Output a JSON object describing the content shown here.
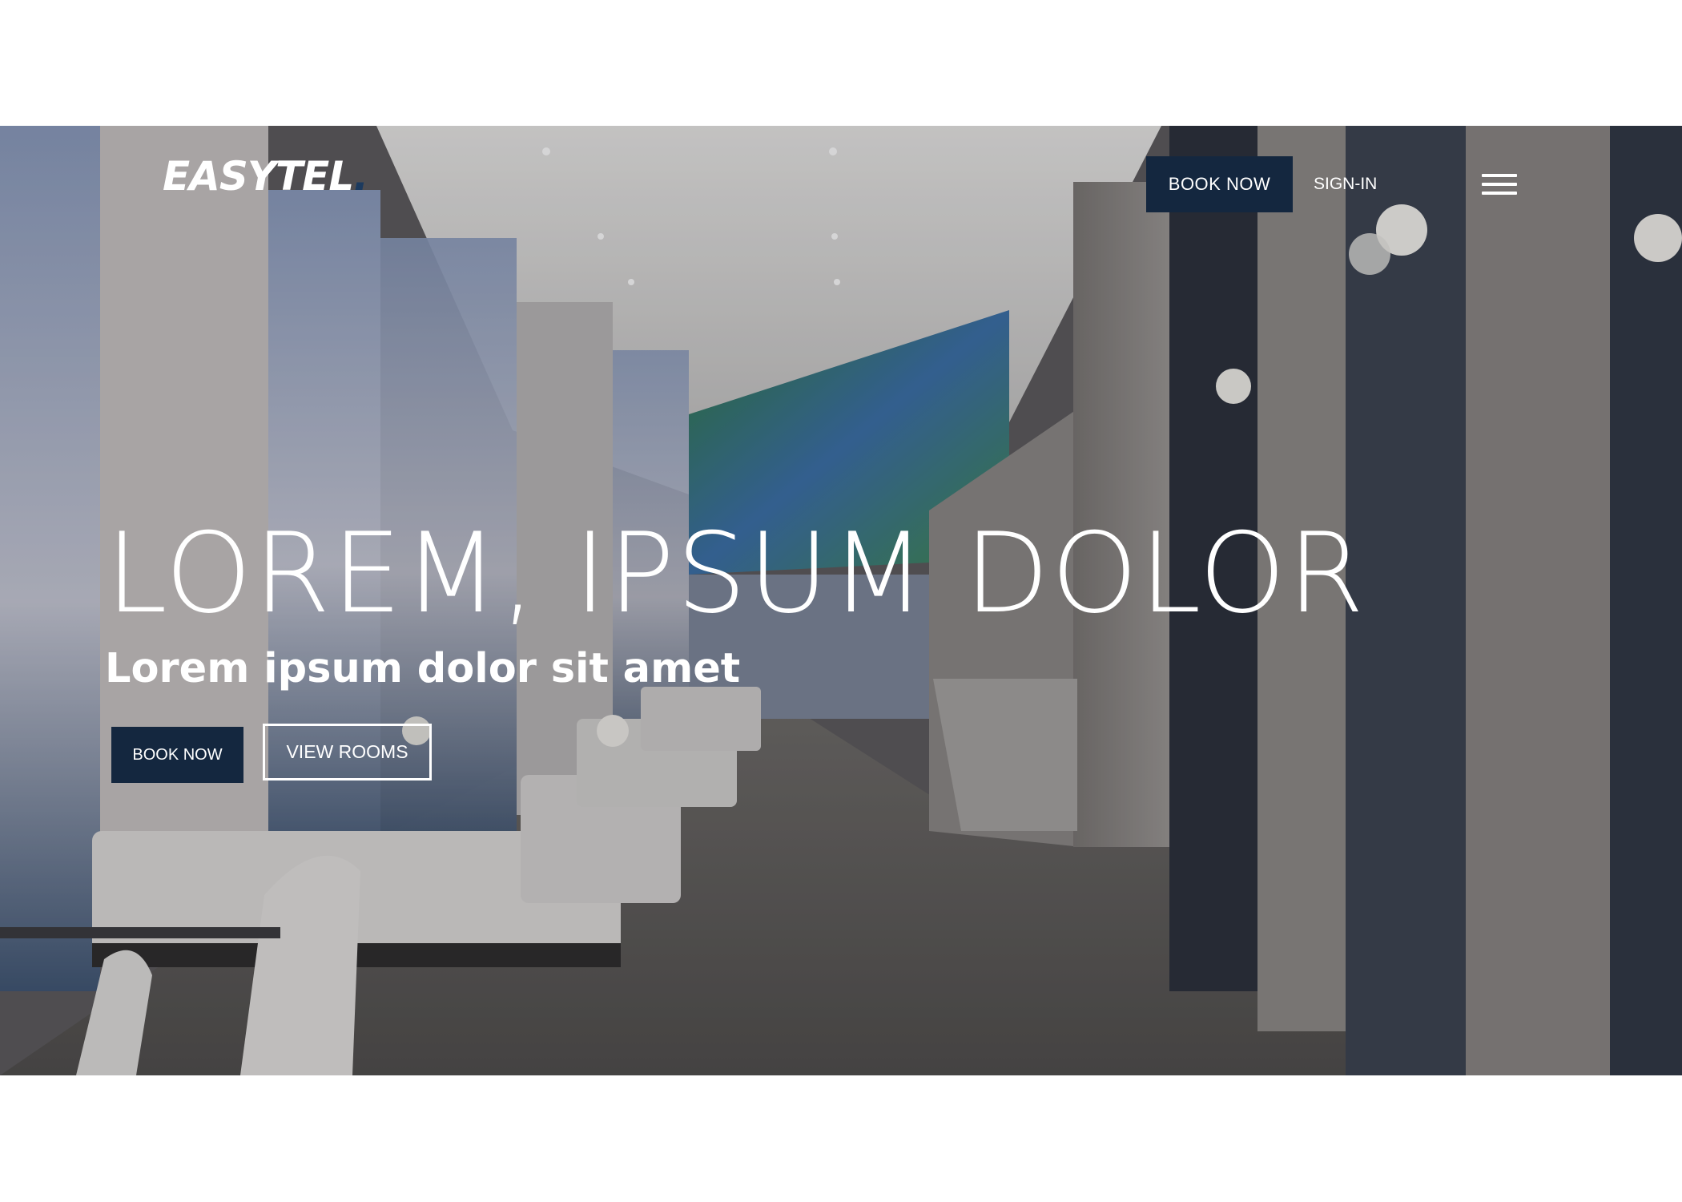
{
  "header": {
    "logo_text": "EASYTEL",
    "logo_dot": ".",
    "book_now_label": "BOOK NOW",
    "sign_in_label": "SIGN-IN",
    "menu_icon": "hamburger-menu-icon"
  },
  "hero": {
    "title": "LOREM, IPSUM DOLOR",
    "subtitle": "Lorem ipsum dolor sit amet",
    "primary_cta_label": "BOOK NOW",
    "secondary_cta_label": "VIEW ROOMS",
    "background_image": "hotel-lounge-photo"
  },
  "colors": {
    "brand_navy": "#14273f",
    "text_light": "#ffffff",
    "page_background": "#ffffff"
  }
}
